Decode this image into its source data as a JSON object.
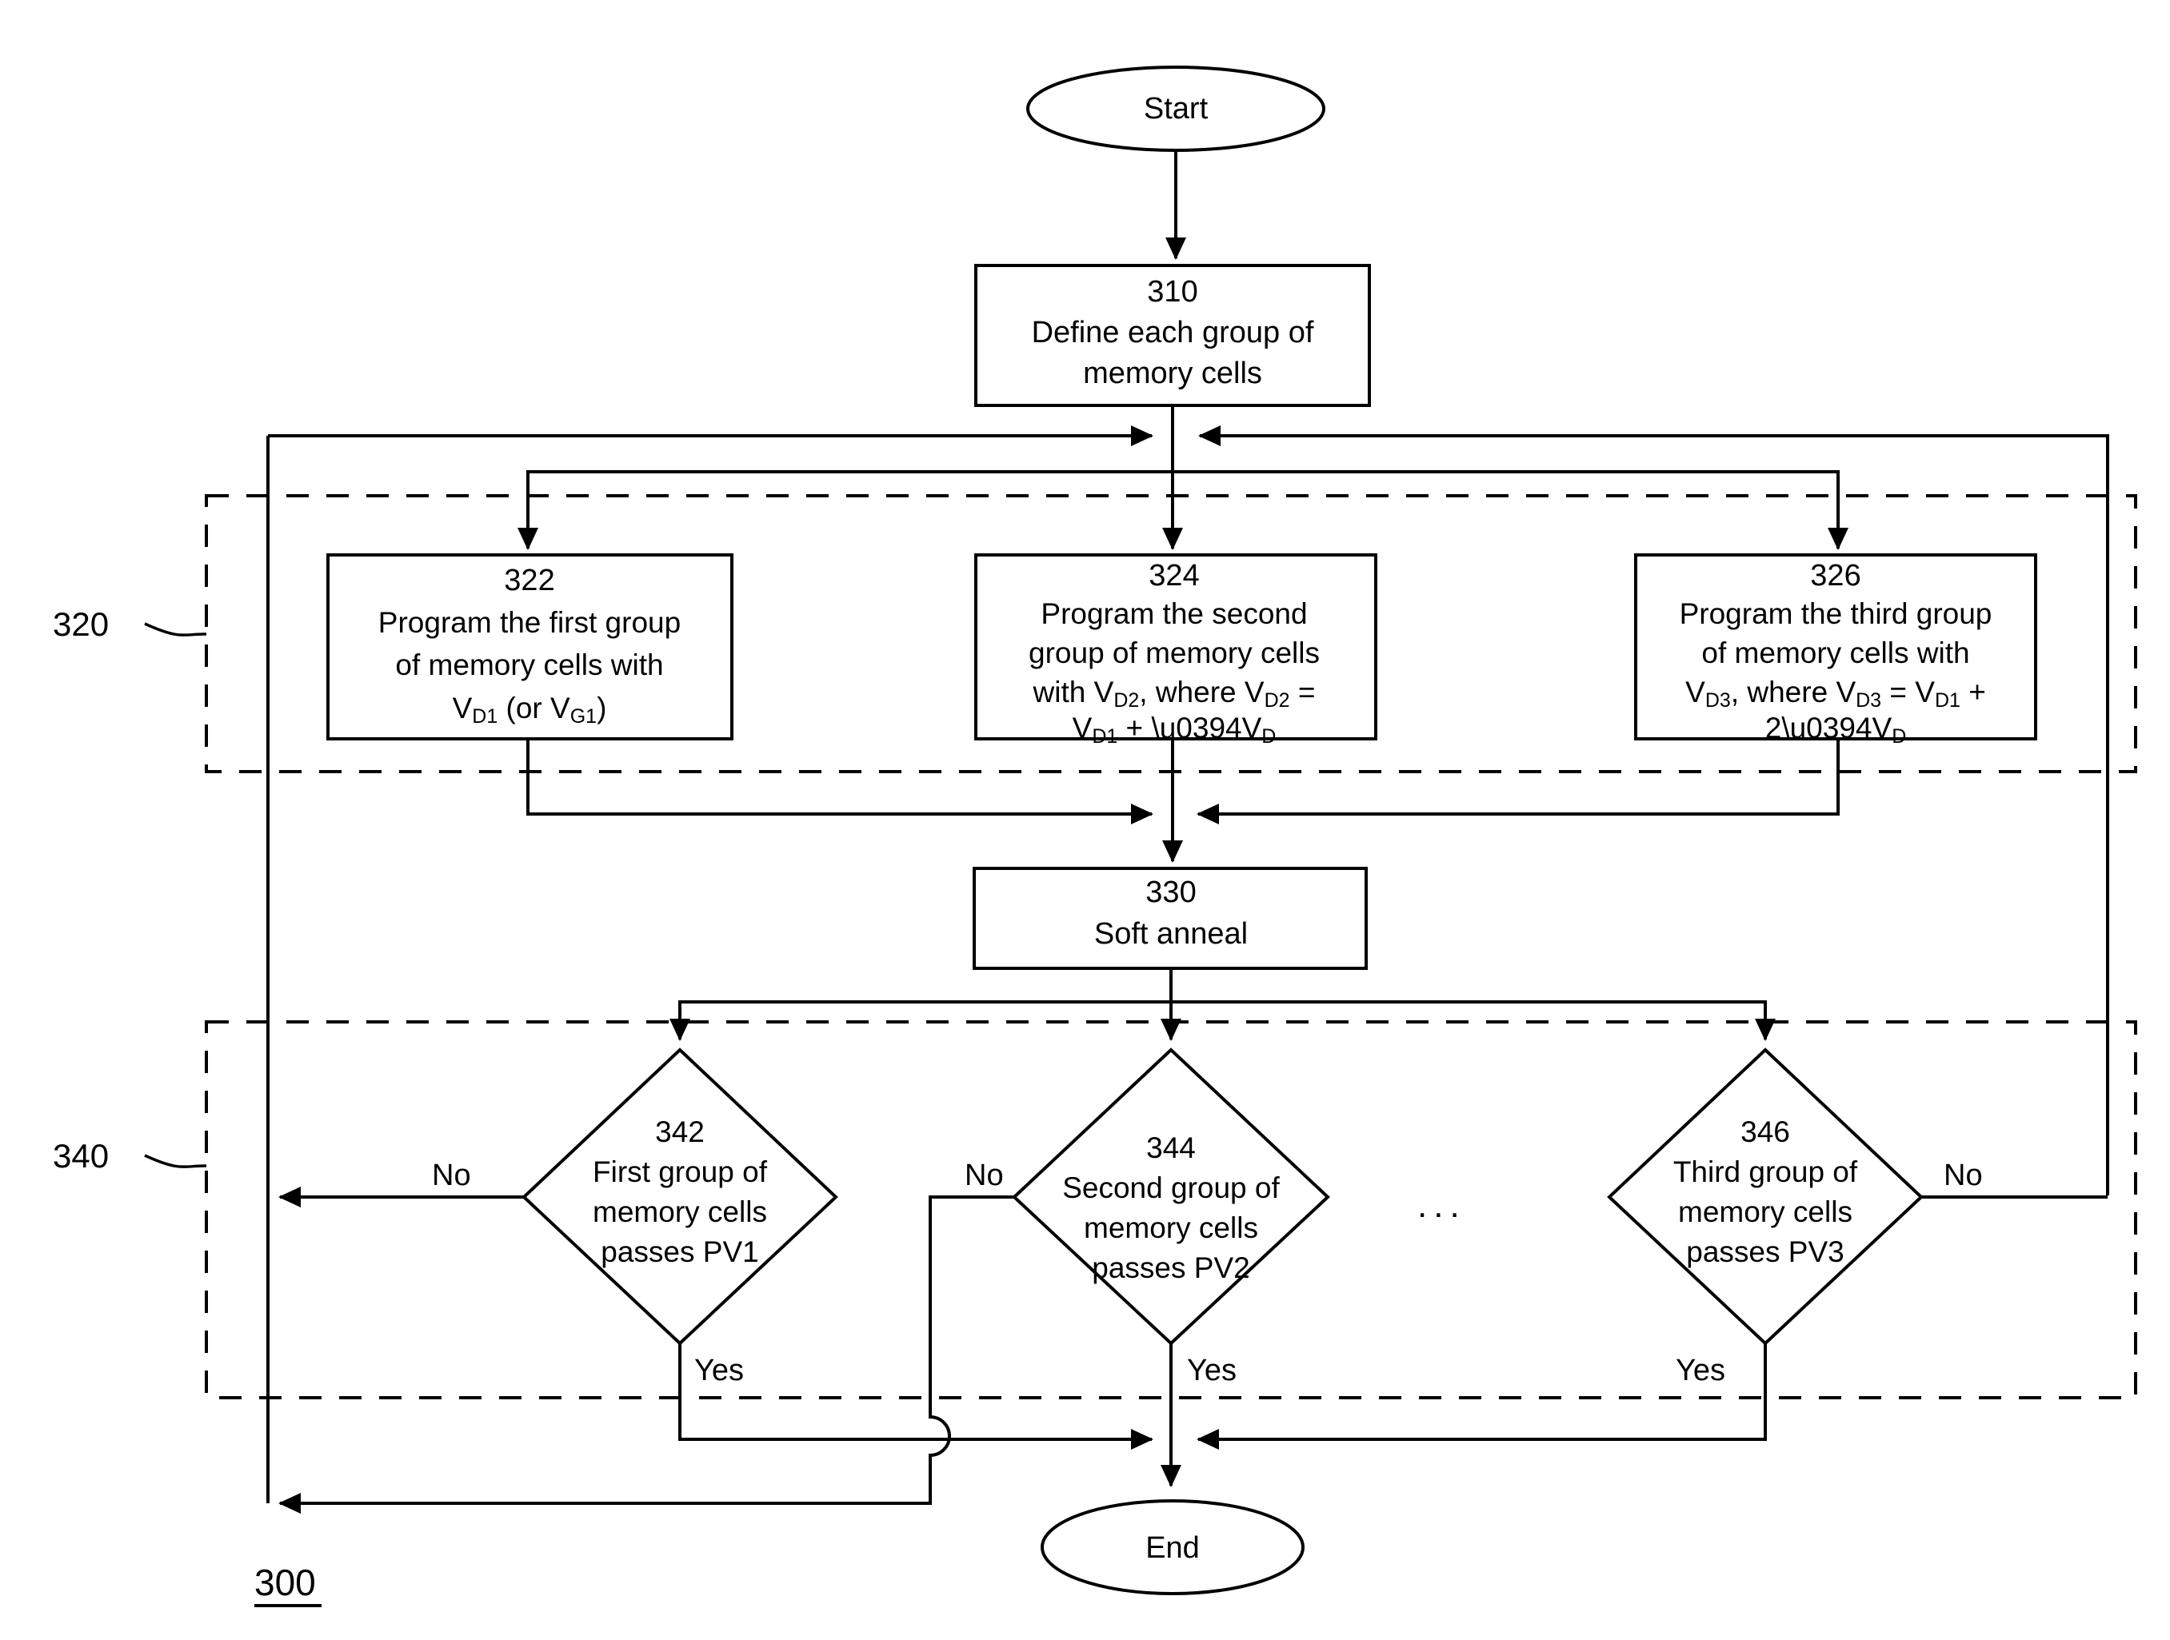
{
  "figure": {
    "number": "300",
    "group_labels": {
      "programming_group": "320",
      "verify_group": "340"
    }
  },
  "nodes": {
    "start": {
      "label": "Start"
    },
    "end": {
      "label": "End"
    },
    "step310": {
      "id": "310",
      "lines": [
        "Define each group of",
        "memory cells"
      ]
    },
    "step322": {
      "id": "322",
      "lines": [
        "Program the first group",
        "of memory cells with"
      ],
      "formula": "V_D1 (or V_G1)"
    },
    "step324": {
      "id": "324",
      "lines": [
        "Program the second",
        "group of memory cells"
      ],
      "formula_line1": "with V_D2, where V_D2 =",
      "formula_line2": "V_D1 + ΔV_D"
    },
    "step326": {
      "id": "326",
      "lines": [
        "Program the third group",
        "of memory cells with"
      ],
      "formula_line1": "V_D3, where V_D3 =  V_D1 +",
      "formula_line2": "2ΔV_D"
    },
    "step330": {
      "id": "330",
      "lines": [
        "Soft anneal"
      ]
    },
    "decision342": {
      "id": "342",
      "lines": [
        "First group of",
        "memory cells",
        "passes PV1"
      ]
    },
    "decision344": {
      "id": "344",
      "lines": [
        "Second group of",
        "memory cells",
        "passes PV2"
      ]
    },
    "decision346": {
      "id": "346",
      "lines": [
        "Third group of",
        "memory cells",
        "passes PV3"
      ]
    },
    "ellipsis": {
      "label": "..."
    }
  },
  "edge_labels": {
    "no_342": "No",
    "yes_342": "Yes",
    "no_344": "No",
    "yes_344": "Yes",
    "no_346": "No",
    "yes_346": "Yes"
  },
  "colors": {
    "stroke": "#000000",
    "fill": "#ffffff"
  }
}
